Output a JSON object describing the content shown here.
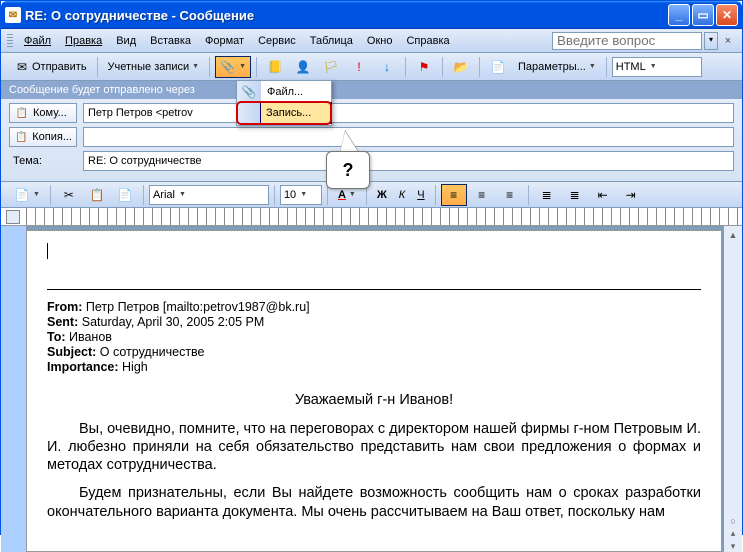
{
  "title": "RE: О сотрудничестве  - Сообщение",
  "menubar": {
    "items": [
      "Файл",
      "Правка",
      "Вид",
      "Вставка",
      "Формат",
      "Сервис",
      "Таблица",
      "Окно",
      "Справка"
    ],
    "help_placeholder": "Введите вопрос"
  },
  "toolbar": {
    "send_label": "Отправить",
    "accounts_label": "Учетные записи",
    "params_label": "Параметры...",
    "format_combo": "HTML"
  },
  "banner": "Сообщение будет отправлено через",
  "fields": {
    "to_btn": "Кому...",
    "to_value": "Петр Петров <petrov",
    "cc_btn": "Копия...",
    "cc_value": "",
    "subject_label": "Тема:",
    "subject_value": "RE: О сотрудничестве"
  },
  "attach_menu": {
    "item_file": "Файл...",
    "item_record": "Запись..."
  },
  "callout": "?",
  "fmt": {
    "font_name": "Arial",
    "font_size": "10"
  },
  "message": {
    "from_label": "From:",
    "from_value": "Петр Петров [mailto:petrov1987@bk.ru]",
    "sent_label": "Sent:",
    "sent_value": "Saturday, April 30, 2005 2:05 PM",
    "to_label": "To:",
    "to_value": "Иванов",
    "subject_label": "Subject:",
    "subject_value": "О сотрудничестве",
    "importance_label": "Importance:",
    "importance_value": "High",
    "salutation": "Уважаемый г-н Иванов!",
    "para1": "Вы, очевидно, помните, что на переговорах с директором нашей фирмы г-ном Петровым И. И. любезно приняли на себя обязательство представить нам свои предложения о формах и методах сотрудничества.",
    "para2": "Будем признательны, если Вы найдете возможность сообщить нам о сроках разработки окончательного варианта документа. Мы очень рассчитываем на Ваш ответ, поскольку нам"
  }
}
